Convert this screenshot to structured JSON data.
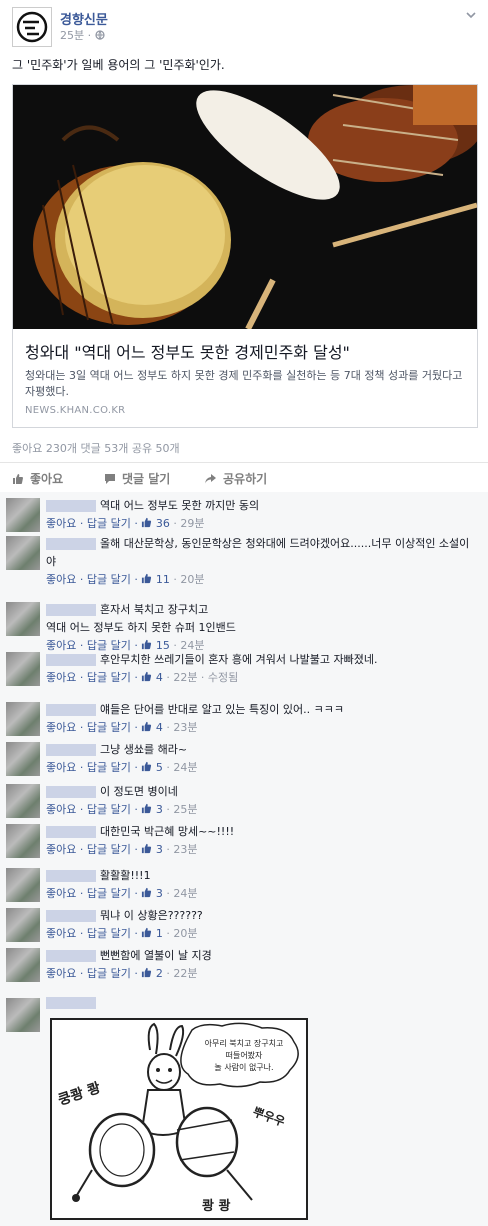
{
  "post": {
    "page_name": "경향신문",
    "time": "25분 · ",
    "text": "그 '민주화'가 일베 용어의 그 '민주화'인가.",
    "link": {
      "title": "청와대 \"역대 어느 정부도 못한 경제민주화 달성\"",
      "description": "청와대는 3일 역대 어느 정부도 하지 못한 경제 민주화를 실천하는 등 7대 정책 성과를 거뒀다고 자평했다.",
      "domain": "NEWS.KHAN.CO.KR"
    },
    "counts": "좋아요 230개  댓글 53개  공유 50개"
  },
  "actions": {
    "like": "좋아요",
    "comment": "댓글 달기",
    "share": "공유하기"
  },
  "comment_actions": {
    "like": "좋아요 · ",
    "reply": "답글 달기 · "
  },
  "comments": [
    {
      "text": "역대 어느 정부도 못한 까지만 동의",
      "likes": "36",
      "time": " · 29분"
    },
    {
      "text": "올해 대산문학상, 동인문학상은 청와대에 드려야겠어요......너무 이상적인 소설이야",
      "likes": "11",
      "time": " · 20분"
    },
    {
      "text": "혼자서 북치고 장구치고\n역대 어느 정부도 하지 못한 슈퍼 1인밴드",
      "likes": "15",
      "time": " · 24분"
    },
    {
      "text": "후안무치한 쓰레기들이 혼자 흥에 겨워서 나발불고 자빠졌네.",
      "likes": "4",
      "time": " · 22분 · 수정됨"
    },
    {
      "text": "얘들은 단어를 반대로 알고 있는 특징이 있어.. ㅋㅋㅋ",
      "likes": "4",
      "time": " · 23분"
    },
    {
      "text": "그냥 생쑈를 해라~",
      "likes": "5",
      "time": " · 24분"
    },
    {
      "text": "이 정도면 병이네",
      "likes": "3",
      "time": " · 25분"
    },
    {
      "text": "대한민국 박근혜 망세~~!!!!",
      "likes": "3",
      "time": " · 23분"
    },
    {
      "text": "활활활!!!1",
      "likes": "3",
      "time": " · 24분"
    },
    {
      "text": "뭐냐 이 상황은??????",
      "likes": "1",
      "time": " · 20분"
    },
    {
      "text": "뻔뻔함에 열불이 날 지경",
      "likes": "2",
      "time": " · 22분"
    }
  ],
  "cartoon": {
    "speech": [
      "아무리 북치고 장구치고",
      "떠들어봤자",
      "놀 사람이 없구나."
    ],
    "sfx": {
      "left": "쿵쾅 쾅",
      "right": "뿌우우",
      "bottom": "쾅 쾅"
    }
  }
}
